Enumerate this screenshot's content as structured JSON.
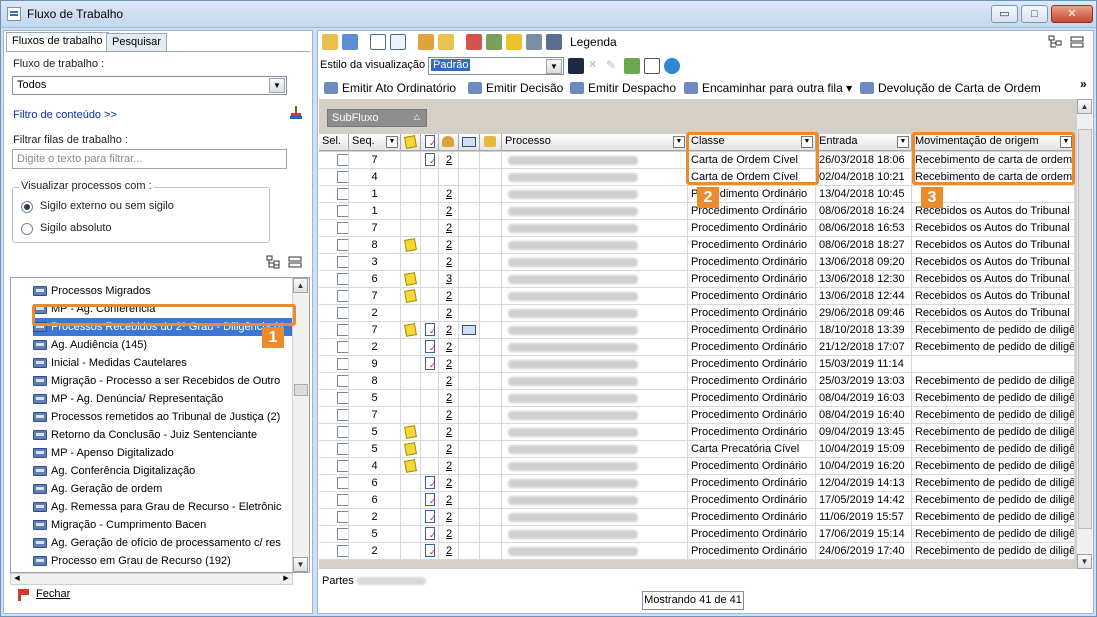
{
  "window": {
    "title": "Fluxo de Trabalho",
    "minimize": "▭",
    "maximize": "□",
    "close": "✕"
  },
  "left": {
    "tabs": [
      {
        "label": "Fluxos de trabalho"
      },
      {
        "label": "Pesquisar"
      }
    ],
    "fluxo_label": "Fluxo de trabalho :",
    "fluxo_value": "Todos",
    "filtro_link": "Filtro de conteúdo >>",
    "filtrar_label": "Filtrar filas de trabalho :",
    "filtrar_placeholder": "Digite o texto para filtrar...",
    "visualizar_title": "Visualizar processos com :",
    "radio_externo": "Sigilo externo ou sem sigilo",
    "radio_absoluto": "Sigilo absoluto",
    "tree_items": [
      "Processos Migrados",
      "MP - Ag. Conferência",
      "Processos Recebidos do 2º Grau - Diligência (4",
      "Ag. Audiência (145)",
      "Inicial - Medidas Cautelares",
      "Migração - Processo a ser Recebidos de Outro",
      "MP - Ag. Denúncia/ Representação",
      "Processos remetidos ao Tribunal de Justiça (2)",
      "Retorno da Conclusão  - Juiz Sentenciante",
      "MP - Apenso Digitalizado",
      "Ag. Conferência Digitalização",
      "Ag. Geração de ordem",
      "Ag. Remessa para Grau de Recurso - Eletrônic",
      "Migração - Cumprimento Bacen",
      "Ag. Geração de ofício de processamento c/ res",
      "Processo em Grau de Recurso (192)"
    ],
    "badge1": "1",
    "fechar": "Fechar"
  },
  "right": {
    "legenda": "Legenda",
    "estilo_label": "Estilo da visualização :",
    "estilo_value": "Padrão",
    "actions": [
      "Emitir Ato Ordinatório",
      "Emitir Decisão",
      "Emitir Despacho",
      "Encaminhar para outra fila ▾",
      "Devolução de Carta de Ordem"
    ],
    "more": "»",
    "subfluxo": "SubFluxo",
    "headers": {
      "sel": "Sel.",
      "seq": "Seq.",
      "processo": "Processo",
      "classe": "Classe",
      "entrada": "Entrada",
      "movimentacao": "Movimentação de origem"
    },
    "badge2": "2",
    "badge3": "3",
    "rows": [
      {
        "seq": "7",
        "note": false,
        "doc": true,
        "n": "2",
        "link": false,
        "classe": "Carta de Ordem Cível",
        "entrada": "26/03/2018 18:06",
        "mov": "Recebimento de carta de ordem"
      },
      {
        "seq": "4",
        "note": false,
        "doc": false,
        "n": "",
        "link": false,
        "classe": "Carta de Ordem Cível",
        "entrada": "02/04/2018 10:21",
        "mov": "Recebimento de carta de ordem"
      },
      {
        "seq": "1",
        "note": false,
        "doc": false,
        "n": "2",
        "link": false,
        "classe": "Procedimento Ordinário",
        "entrada": "13/04/2018 10:45",
        "mov": ""
      },
      {
        "seq": "1",
        "note": false,
        "doc": false,
        "n": "2",
        "link": false,
        "classe": "Procedimento Ordinário",
        "entrada": "08/06/2018 16:24",
        "mov": "Recebidos os Autos do Tribunal"
      },
      {
        "seq": "7",
        "note": false,
        "doc": false,
        "n": "2",
        "link": false,
        "classe": "Procedimento Ordinário",
        "entrada": "08/06/2018 16:53",
        "mov": "Recebidos os Autos do Tribunal"
      },
      {
        "seq": "8",
        "note": true,
        "doc": false,
        "n": "2",
        "link": false,
        "classe": "Procedimento Ordinário",
        "entrada": "08/06/2018 18:27",
        "mov": "Recebidos os Autos do Tribunal"
      },
      {
        "seq": "3",
        "note": false,
        "doc": false,
        "n": "2",
        "link": false,
        "classe": "Procedimento Ordinário",
        "entrada": "13/06/2018 09:20",
        "mov": "Recebidos os Autos do Tribunal"
      },
      {
        "seq": "6",
        "note": true,
        "doc": false,
        "n": "3",
        "link": false,
        "classe": "Procedimento Ordinário",
        "entrada": "13/06/2018 12:30",
        "mov": "Recebidos os Autos do Tribunal"
      },
      {
        "seq": "7",
        "note": true,
        "doc": false,
        "n": "2",
        "link": false,
        "classe": "Procedimento Ordinário",
        "entrada": "13/06/2018 12:44",
        "mov": "Recebidos os Autos do Tribunal"
      },
      {
        "seq": "2",
        "note": false,
        "doc": false,
        "n": "2",
        "link": false,
        "classe": "Procedimento Ordinário",
        "entrada": "29/06/2018 09:46",
        "mov": "Recebidos os Autos do Tribunal"
      },
      {
        "seq": "7",
        "note": true,
        "doc": true,
        "n": "2",
        "link": true,
        "classe": "Procedimento Ordinário",
        "entrada": "18/10/2018 13:39",
        "mov": "Recebimento de pedido de diligê"
      },
      {
        "seq": "2",
        "note": false,
        "doc": true,
        "n": "2",
        "link": false,
        "classe": "Procedimento Ordinário",
        "entrada": "21/12/2018 17:07",
        "mov": "Recebimento de pedido de diligê"
      },
      {
        "seq": "9",
        "note": false,
        "doc": true,
        "n": "2",
        "link": false,
        "classe": "Procedimento Ordinário",
        "entrada": "15/03/2019 11:14",
        "mov": ""
      },
      {
        "seq": "8",
        "note": false,
        "doc": false,
        "n": "2",
        "link": false,
        "classe": "Procedimento Ordinário",
        "entrada": "25/03/2019 13:03",
        "mov": "Recebimento de pedido de diligê"
      },
      {
        "seq": "5",
        "note": false,
        "doc": false,
        "n": "2",
        "link": false,
        "classe": "Procedimento Ordinário",
        "entrada": "08/04/2019 16:03",
        "mov": "Recebimento de pedido de diligê"
      },
      {
        "seq": "7",
        "note": false,
        "doc": false,
        "n": "2",
        "link": false,
        "classe": "Procedimento Ordinário",
        "entrada": "08/04/2019 16:40",
        "mov": "Recebimento de pedido de diligê"
      },
      {
        "seq": "5",
        "note": true,
        "doc": false,
        "n": "2",
        "link": false,
        "classe": "Procedimento Ordinário",
        "entrada": "09/04/2019 13:45",
        "mov": "Recebimento de pedido de diligê"
      },
      {
        "seq": "5",
        "note": true,
        "doc": false,
        "n": "2",
        "link": false,
        "classe": "Carta Precatória Cível",
        "entrada": "10/04/2019 15:09",
        "mov": "Recebimento de pedido de diligê"
      },
      {
        "seq": "4",
        "note": true,
        "doc": false,
        "n": "2",
        "link": false,
        "classe": "Procedimento Ordinário",
        "entrada": "10/04/2019 16:20",
        "mov": "Recebimento de pedido de diligê"
      },
      {
        "seq": "6",
        "note": false,
        "doc": true,
        "n": "2",
        "link": false,
        "classe": "Procedimento Ordinário",
        "entrada": "12/04/2019 14:13",
        "mov": "Recebimento de pedido de diligê"
      },
      {
        "seq": "6",
        "note": false,
        "doc": true,
        "n": "2",
        "link": false,
        "classe": "Procedimento Ordinário",
        "entrada": "17/05/2019 14:42",
        "mov": "Recebimento de pedido de diligê"
      },
      {
        "seq": "2",
        "note": false,
        "doc": true,
        "n": "2",
        "link": false,
        "classe": "Procedimento Ordinário",
        "entrada": "11/06/2019 15:57",
        "mov": "Recebimento de pedido de diligê"
      },
      {
        "seq": "5",
        "note": false,
        "doc": true,
        "n": "2",
        "link": false,
        "classe": "Procedimento Ordinário",
        "entrada": "17/06/2019 15:14",
        "mov": "Recebimento de pedido de diligê"
      },
      {
        "seq": "2",
        "note": false,
        "doc": true,
        "n": "2",
        "link": false,
        "classe": "Procedimento Ordinário",
        "entrada": "24/06/2019 17:40",
        "mov": "Recebimento de pedido de diligê"
      }
    ],
    "partes": "Partes",
    "mostrando": "Mostrando 41 de 41"
  },
  "colors": {
    "highlight": "#ec8a2e",
    "selection": "#3a78d4",
    "chrome": "#cfe0f2"
  }
}
